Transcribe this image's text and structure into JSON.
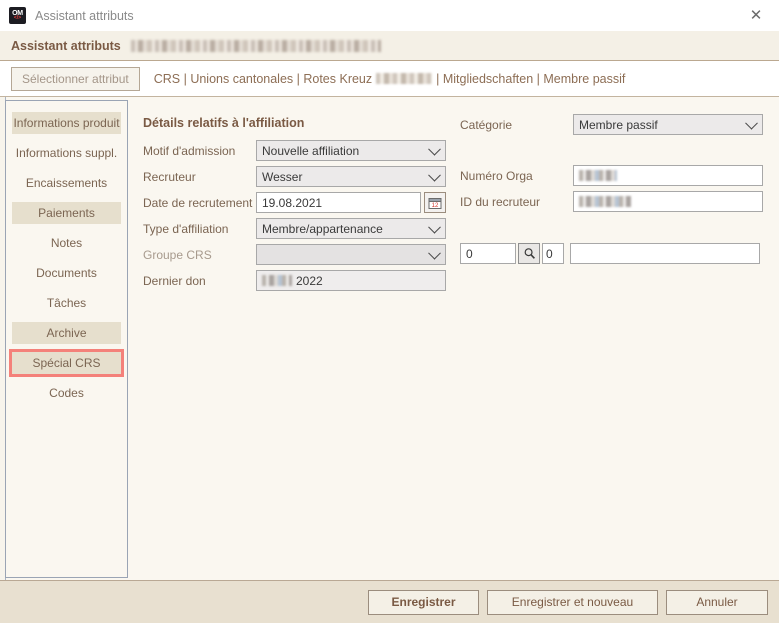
{
  "window": {
    "title": "Assistant attributs",
    "app_icon": "om-logo-icon",
    "close_label": "✕"
  },
  "header": {
    "title": "Assistant attributs",
    "redacted_subtitle": ""
  },
  "toolbar": {
    "select_attribute_label": "Sélectionner attribut",
    "breadcrumb": {
      "part1": "CRS | Unions cantonales | Rotes Kreuz",
      "part2": "| Mitgliedschaften | Membre passif"
    }
  },
  "sidebar": {
    "items": [
      {
        "label": "Informations produit",
        "state": "shaded"
      },
      {
        "label": "Informations suppl.",
        "state": "normal"
      },
      {
        "label": "Encaissements",
        "state": "normal"
      },
      {
        "label": "Paiements",
        "state": "shaded"
      },
      {
        "label": "Notes",
        "state": "normal"
      },
      {
        "label": "Documents",
        "state": "normal"
      },
      {
        "label": "Tâches",
        "state": "normal"
      },
      {
        "label": "Archive",
        "state": "shaded"
      },
      {
        "label": "Spécial CRS",
        "state": "highlighted"
      },
      {
        "label": "Codes",
        "state": "normal"
      }
    ],
    "highlight_color": "#f4817a"
  },
  "main": {
    "section_title": "Détails relatifs à l'affiliation",
    "fields": {
      "motif_admission": {
        "label": "Motif d'admission",
        "value": "Nouvelle affiliation",
        "type": "select"
      },
      "recruteur": {
        "label": "Recruteur",
        "value": "Wesser",
        "type": "select"
      },
      "date_recrutement": {
        "label": "Date de recrutement",
        "value": "19.08.2021",
        "type": "textbox",
        "picker_icon": "calendar-icon"
      },
      "type_affiliation": {
        "label": "Type d'affiliation",
        "value": "Membre/appartenance",
        "type": "select"
      },
      "groupe_crs": {
        "label": "Groupe CRS",
        "value": "",
        "type": "select",
        "disabled": true
      },
      "dernier_don": {
        "label": "Dernier don",
        "value": "2022",
        "type": "readonly"
      },
      "categorie": {
        "label": "Catégorie",
        "value": "Membre passif",
        "type": "select"
      },
      "numero_orga": {
        "label": "Numéro Orga",
        "value": "",
        "type": "textbox"
      },
      "id_recruteur": {
        "label": "ID du recruteur",
        "value": "",
        "type": "textbox"
      },
      "lookup_left": {
        "value": "0",
        "type": "textbox"
      },
      "lookup_right": {
        "value": "0",
        "type": "textbox"
      },
      "lookup_text": {
        "value": "",
        "type": "textbox"
      },
      "search_icon": "magnifier-icon"
    }
  },
  "footer": {
    "save_label": "Enregistrer",
    "save_new_label": "Enregistrer et nouveau",
    "cancel_label": "Annuler"
  }
}
